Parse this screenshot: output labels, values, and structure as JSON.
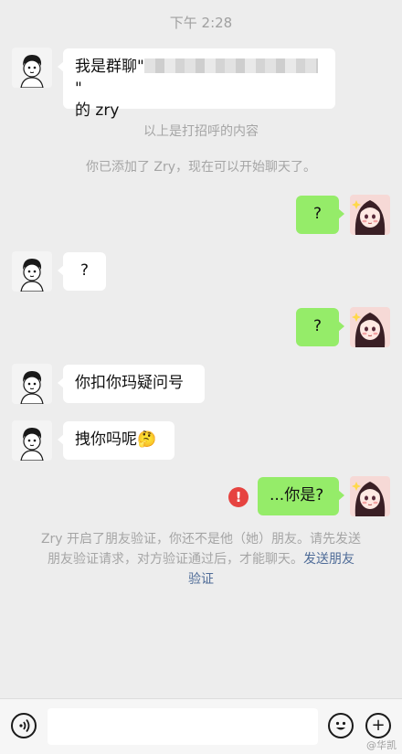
{
  "status_time": "下午 2:28",
  "messages": {
    "m1_line1_prefix": "我是群聊\"",
    "m1_line1_suffix": "\"",
    "m1_line2": "的 zry",
    "m2": "?",
    "m3": "?",
    "m4": "?",
    "m5": "你扣你玛疑问号",
    "m6": "拽你吗呢",
    "m6_emoji": "🤔",
    "m7": "...你是?"
  },
  "system": {
    "greeting_note": "以上是打招呼的内容",
    "added_note": "你已添加了 Zry，现在可以开始聊天了。",
    "verify_line1": "Zry 开启了朋友验证，你还不是他（她）朋友。请先发送",
    "verify_line2_prefix": "朋友验证请求，对方验证通过后，才能聊天。",
    "verify_link_part1": "发送朋友",
    "verify_link_part2": "验证"
  },
  "error_symbol": "!",
  "input_bar": {
    "voice_icon": "voice-icon",
    "emoji_icon": "emoji-icon",
    "plus_icon": "plus-icon",
    "plus_glyph": "+"
  },
  "watermark": "@华凯",
  "colors": {
    "background": "#ededed",
    "incoming_bubble": "#ffffff",
    "outgoing_bubble": "#95ec69",
    "link": "#4f6c98",
    "error": "#e64340"
  }
}
